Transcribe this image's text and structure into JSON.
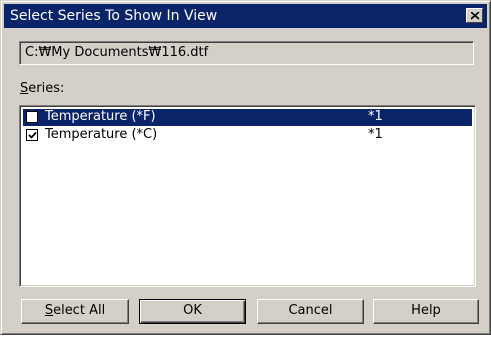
{
  "dialog": {
    "title": "Select Series To Show In View",
    "path": "C:₩My Documents₩116.dtf"
  },
  "series_label": {
    "accel": "S",
    "rest": "eries:"
  },
  "series": [
    {
      "name": "Temperature (*F)",
      "value": "*1",
      "checked": false,
      "selected": true
    },
    {
      "name": "Temperature (*C)",
      "value": "*1",
      "checked": true,
      "selected": false
    }
  ],
  "buttons": {
    "select_all_accel": "S",
    "select_all_rest": "elect All",
    "ok": "OK",
    "cancel": "Cancel",
    "help": "Help"
  },
  "colors": {
    "face": "#d4d0c8",
    "titlebar": "#0a246a",
    "selection": "#0a246a"
  }
}
